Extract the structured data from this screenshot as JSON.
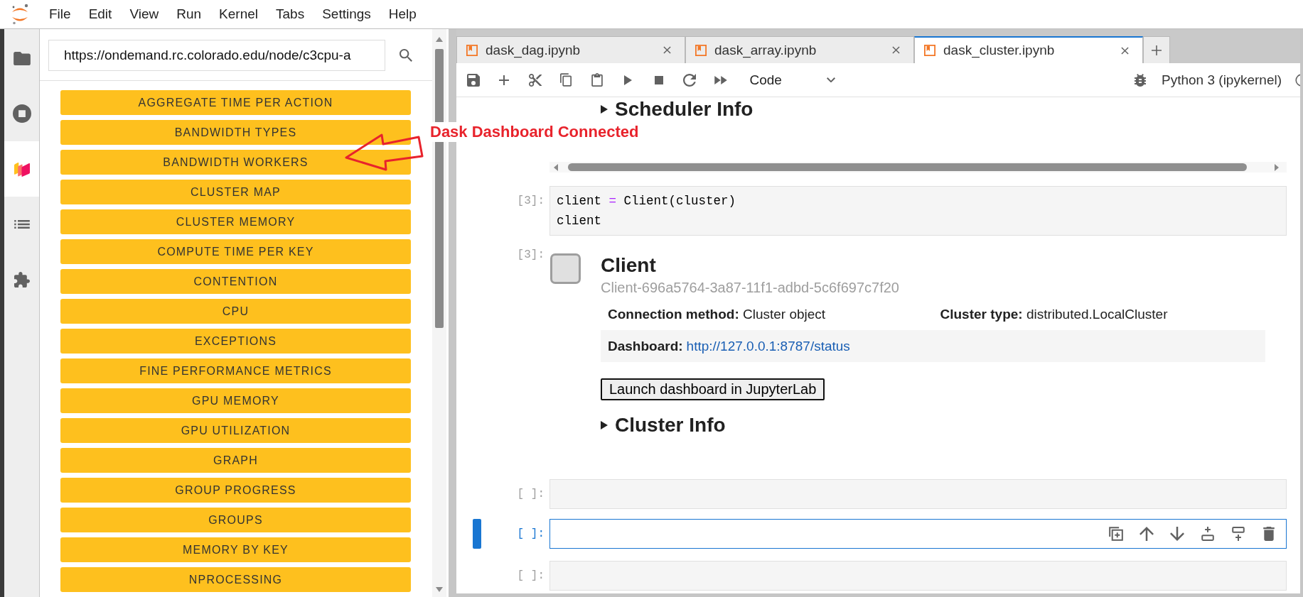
{
  "menu_bar": {
    "items": [
      "File",
      "Edit",
      "View",
      "Run",
      "Kernel",
      "Tabs",
      "Settings",
      "Help"
    ]
  },
  "left_sidebar": {
    "tabs": [
      {
        "selected": false
      },
      {
        "selected": false
      },
      {
        "selected": true
      },
      {
        "selected": false
      },
      {
        "selected": false
      }
    ]
  },
  "dashboard_panel": {
    "url_field": {
      "value": "https://ondemand.rc.colorado.edu/node/c3cpu-a"
    },
    "plot_buttons": [
      "AGGREGATE TIME PER ACTION",
      "BANDWIDTH TYPES",
      "BANDWIDTH WORKERS",
      "CLUSTER MAP",
      "CLUSTER MEMORY",
      "COMPUTE TIME PER KEY",
      "CONTENTION",
      "CPU",
      "EXCEPTIONS",
      "FINE PERFORMANCE METRICS",
      "GPU MEMORY",
      "GPU UTILIZATION",
      "GRAPH",
      "GROUP PROGRESS",
      "GROUPS",
      "MEMORY BY KEY",
      "NPROCESSING"
    ]
  },
  "annotation": {
    "text": "Dask Dashboard Connected"
  },
  "notebook_tabs": [
    {
      "label": "dask_dag.ipynb",
      "selected": false
    },
    {
      "label": "dask_array.ipynb",
      "selected": false
    },
    {
      "label": "dask_cluster.ipynb",
      "selected": true
    }
  ],
  "toolbar": {
    "cell_type": "Code",
    "kernel": "Python 3 (ipykernel)"
  },
  "notebook": {
    "previous_output": {
      "summary": "Scheduler Info"
    },
    "cells": [
      {
        "prompt": "[3]:",
        "selected": false,
        "lines": [
          [
            {
              "kind": "name",
              "text": "client "
            },
            {
              "kind": "operator",
              "text": "="
            },
            {
              "kind": "name",
              "text": " Client(cluster)"
            }
          ],
          [
            {
              "kind": "name",
              "text": "client"
            }
          ]
        ],
        "output": {
          "prompt": "[3]:",
          "title": "Client",
          "id": "Client-696a5764-3a87-11f1-adbd-5c6f697c7f20",
          "fields": [
            "**Connection method:** Cluster object",
            "**Cluster type:** distributed.LocalCluster"
          ],
          "dashboard": {
            "label": "Dashboard:",
            "url": "http://127.0.0.1:8787/status"
          },
          "button": "Launch dashboard in JupyterLab",
          "summary": "Cluster Info"
        }
      },
      {
        "prompt": "[ ]:",
        "selected": false
      },
      {
        "prompt": "[ ]:",
        "selected": true
      },
      {
        "prompt": "[ ]:",
        "selected": false
      }
    ]
  }
}
